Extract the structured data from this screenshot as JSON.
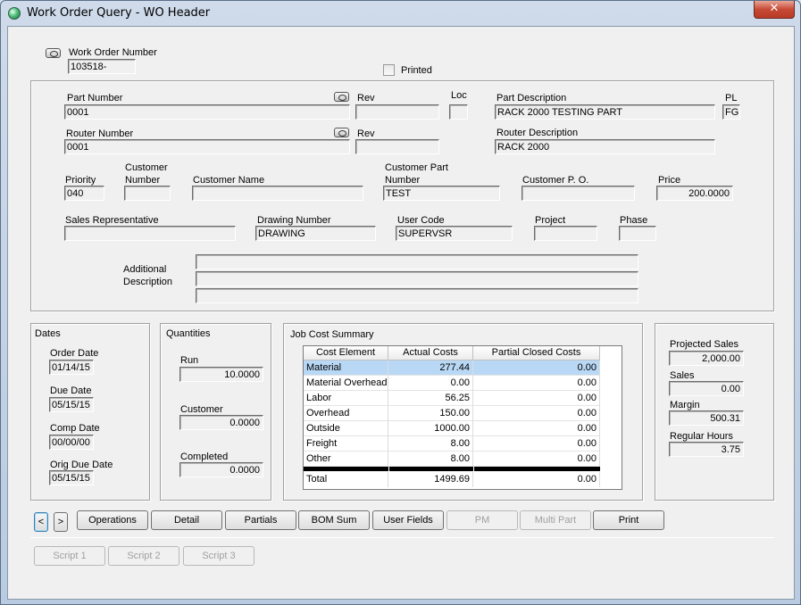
{
  "window": {
    "title": "Work Order Query - WO Header",
    "close": "✕"
  },
  "header": {
    "wo_number_label": "Work Order Number",
    "wo_number": "103518-",
    "printed_label": "Printed",
    "printed": false
  },
  "part": {
    "part_number_label": "Part Number",
    "part_number": "0001",
    "rev_label": "Rev",
    "rev": "",
    "loc_label": "Loc",
    "loc": "",
    "part_desc_label": "Part Description",
    "part_desc": "RACK 2000 TESTING PART",
    "pl_label": "PL",
    "pl": "FG",
    "router_number_label": "Router Number",
    "router_number": "0001",
    "router_rev_label": "Rev",
    "router_rev": "",
    "router_desc_label": "Router Description",
    "router_desc": "RACK 2000",
    "priority_label": "Priority",
    "priority": "040",
    "customer_number_label": "Customer Number",
    "customer_number": "",
    "customer_name_label": "Customer Name",
    "customer_name": "",
    "customer_part_label": "Customer Part Number",
    "customer_part": "TEST",
    "customer_po_label": "Customer P. O.",
    "customer_po": "",
    "price_label": "Price",
    "price": "200.0000",
    "sales_rep_label": "Sales Representative",
    "sales_rep": "",
    "drawing_label": "Drawing Number",
    "drawing": "DRAWING",
    "user_code_label": "User Code",
    "user_code": "SUPERVSR",
    "project_label": "Project",
    "project": "",
    "phase_label": "Phase",
    "phase": "",
    "additional_desc_label": "Additional Description",
    "additional_desc": [
      "",
      "",
      ""
    ]
  },
  "dates": {
    "title": "Dates",
    "order_label": "Order Date",
    "order": "01/14/15",
    "due_label": "Due Date",
    "due": "05/15/15",
    "comp_label": "Comp Date",
    "comp": "00/00/00",
    "orig_due_label": "Orig Due Date",
    "orig_due": "05/15/15"
  },
  "quantities": {
    "title": "Quantities",
    "run_label": "Run",
    "run": "10.0000",
    "customer_label": "Customer",
    "customer": "0.0000",
    "completed_label": "Completed",
    "completed": "0.0000"
  },
  "job_cost": {
    "title": "Job Cost Summary",
    "columns": [
      "Cost Element",
      "Actual Costs",
      "Partial Closed Costs"
    ],
    "rows": [
      [
        "Material",
        "277.44",
        "0.00"
      ],
      [
        "Material Overhead",
        "0.00",
        "0.00"
      ],
      [
        "Labor",
        "56.25",
        "0.00"
      ],
      [
        "Overhead",
        "150.00",
        "0.00"
      ],
      [
        "Outside",
        "1000.00",
        "0.00"
      ],
      [
        "Freight",
        "8.00",
        "0.00"
      ],
      [
        "Other",
        "8.00",
        "0.00"
      ]
    ],
    "total": [
      "Total",
      "1499.69",
      "0.00"
    ]
  },
  "summary": {
    "projected_sales_label": "Projected Sales",
    "projected_sales": "2,000.00",
    "sales_label": "Sales",
    "sales": "0.00",
    "margin_label": "Margin",
    "margin": "500.31",
    "regular_hours_label": "Regular Hours",
    "regular_hours": "3.75"
  },
  "buttons": {
    "prev": "<",
    "next": ">",
    "operations": "Operations",
    "detail": "Detail",
    "partials": "Partials",
    "bom_sum": "BOM Sum",
    "user_fields": "User Fields",
    "pm": "PM",
    "multi_part": "Multi Part",
    "print": "Print",
    "script1": "Script 1",
    "script2": "Script 2",
    "script3": "Script 3"
  }
}
